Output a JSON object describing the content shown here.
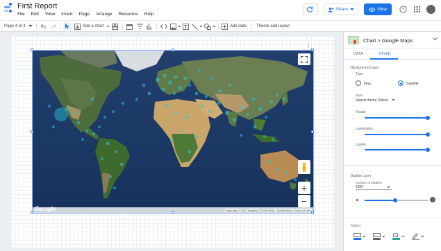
{
  "app": {
    "title": "First Report",
    "menu": [
      "File",
      "Edit",
      "View",
      "Insert",
      "Page",
      "Arrange",
      "Resource",
      "Help"
    ],
    "share_label": "Share",
    "view_label": "View"
  },
  "toolbar": {
    "page_indicator": "Page 4 of 4",
    "add_chart_label": "Add a chart",
    "add_data_label": "Add data",
    "theme_label": "Theme and layout"
  },
  "map": {
    "google_label": "Google",
    "attribution": "Map data ©2020 Imagery ©2020 NASA, TerraMetrics | Terms of Use",
    "zoom_in": "+",
    "zoom_out": "−"
  },
  "panel": {
    "title": "Chart > Google Maps",
    "tabs": [
      "DATA",
      "STYLE"
    ],
    "active_tab": "STYLE",
    "background_layer_label": "Background Layer",
    "type_label": "Type",
    "type_options": [
      "Map",
      "Satellite"
    ],
    "selected_type": "Satellite",
    "style_label": "Style",
    "style_value": "Report theme (Silver)",
    "roads_label": "Roads",
    "landmarks_label": "Landmarks",
    "labels_label": "Labels",
    "bubble_layer_label": "Bubble Layer",
    "number_of_bubbles_label": "Number of bubbles",
    "number_of_bubbles_value": "1000",
    "colors_label": "Colors"
  },
  "colors": {
    "accent": "#1a73e8",
    "bubble": "#26c6da"
  }
}
